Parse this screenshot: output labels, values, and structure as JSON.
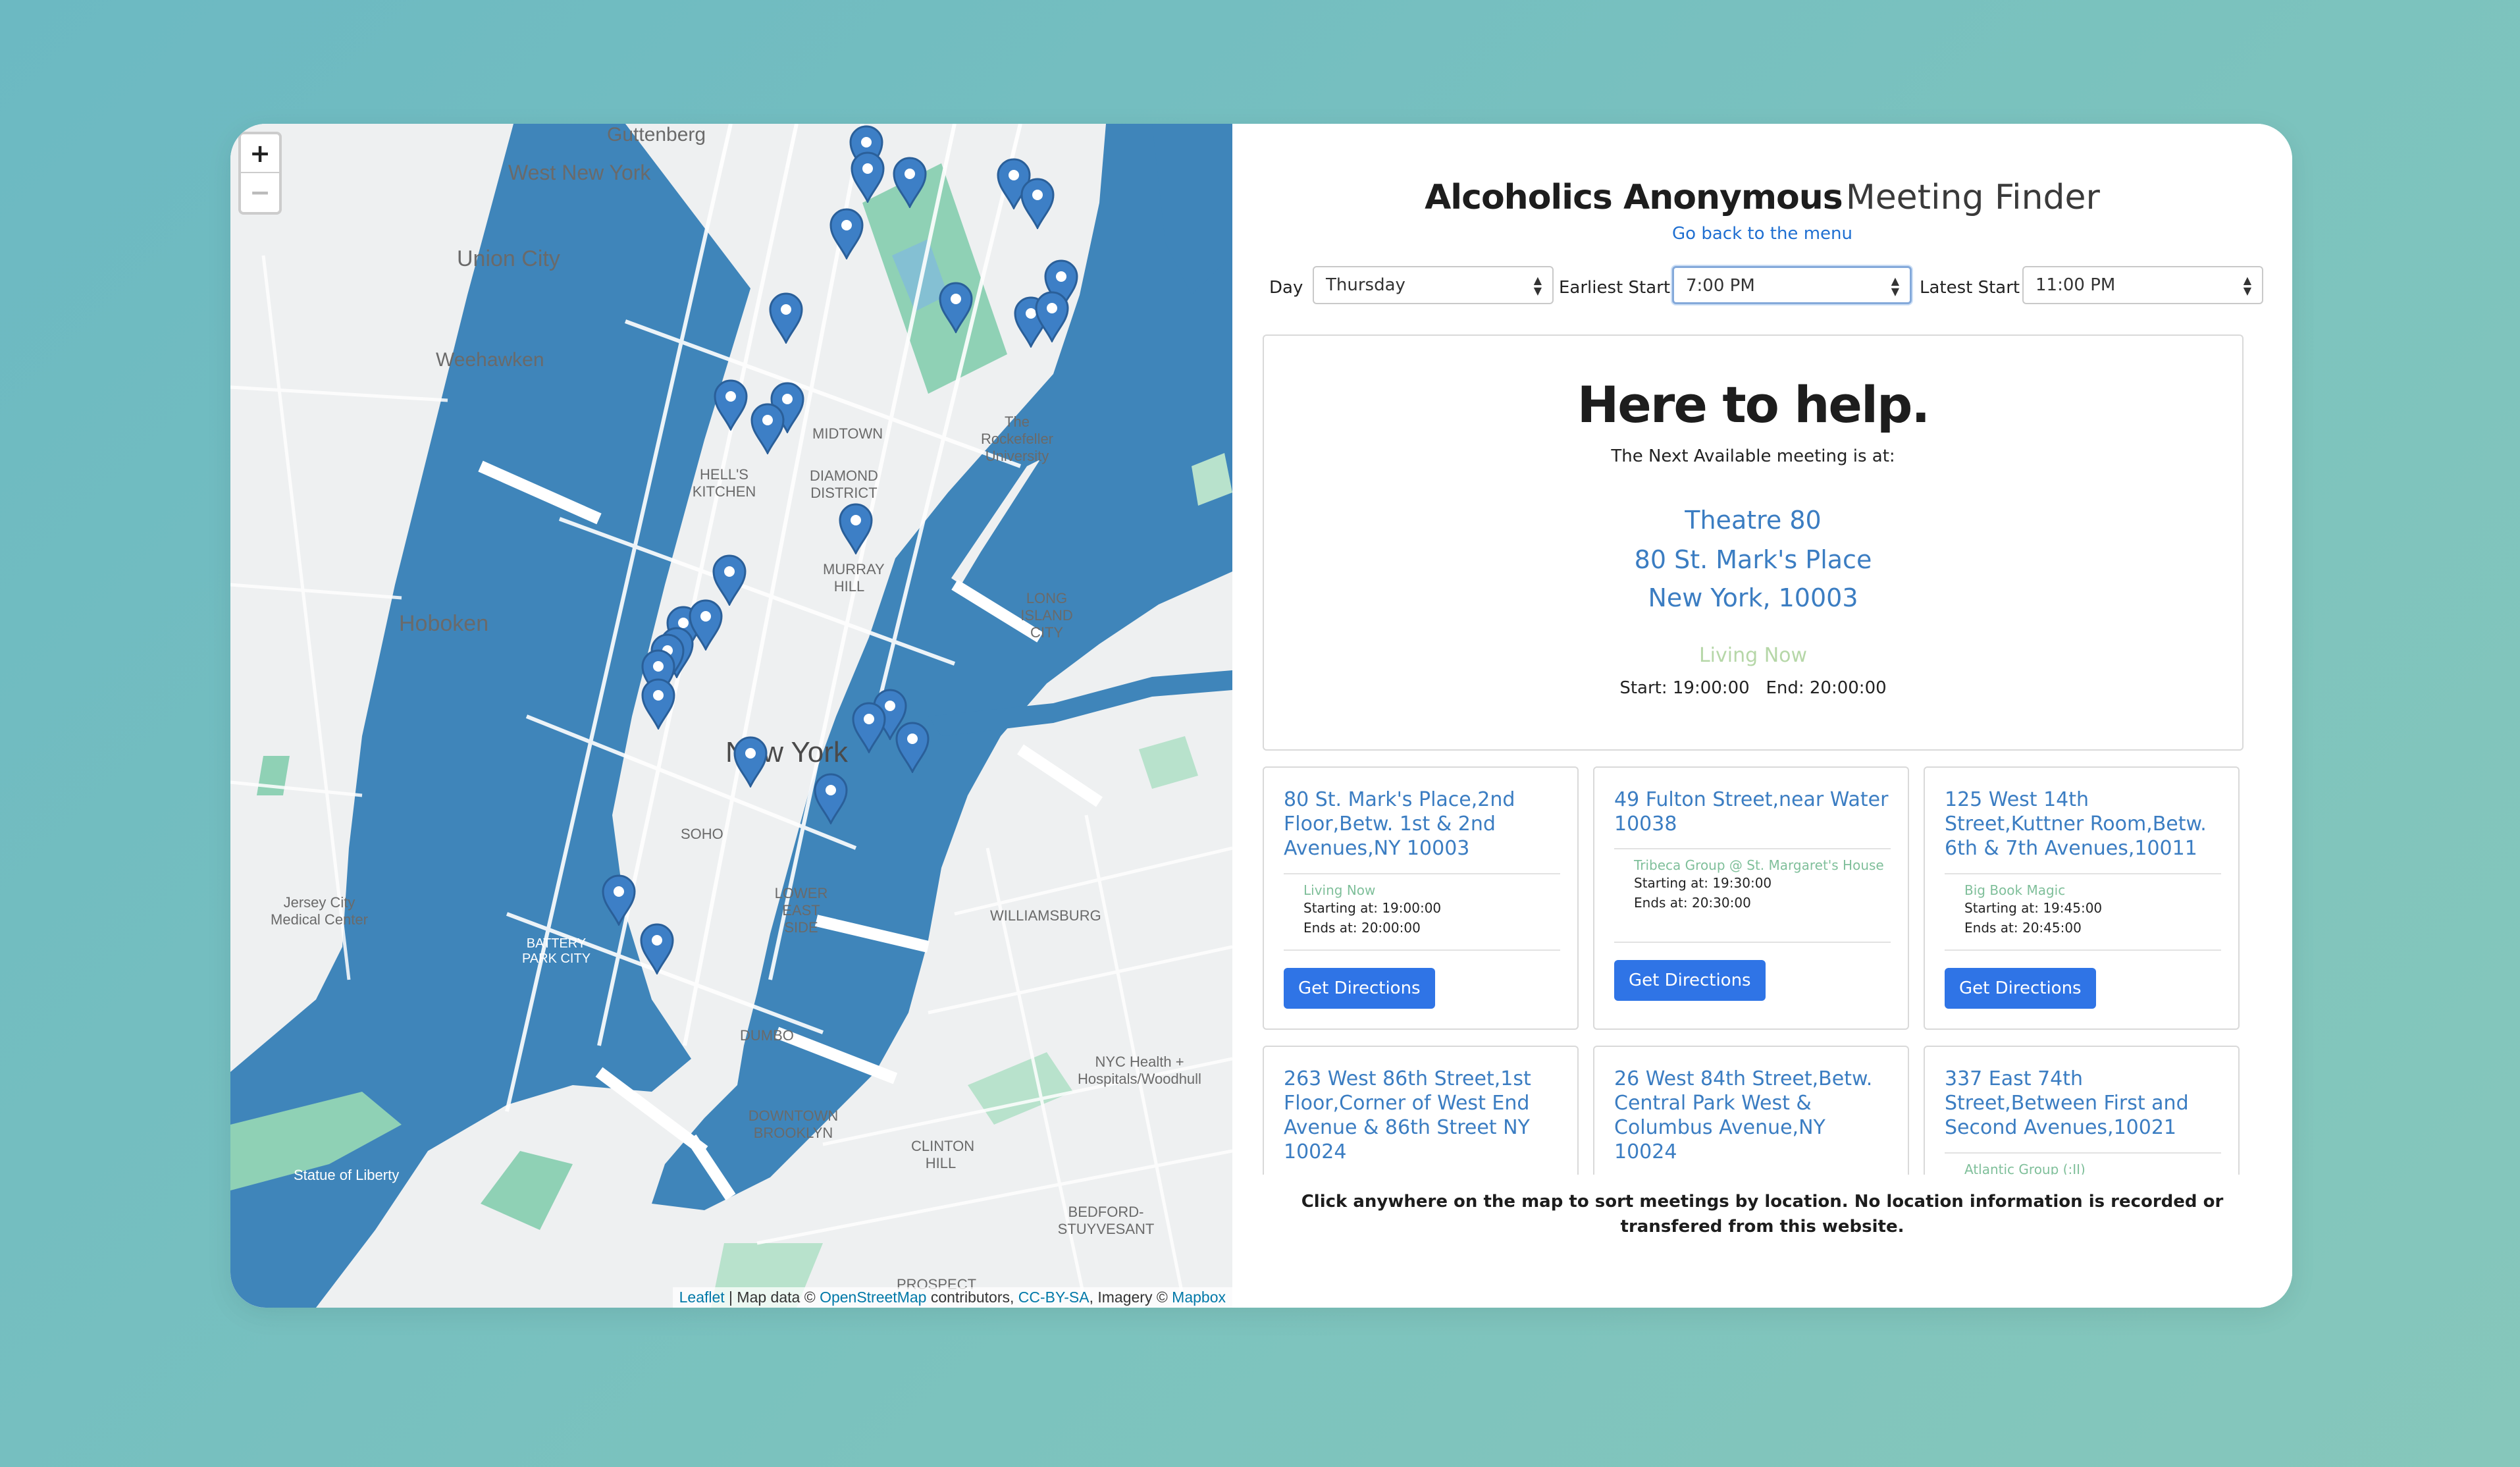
{
  "app": {
    "title_bold": "Alcoholics Anonymous",
    "title_light": "Meeting Finder",
    "back_link": "Go back to the menu"
  },
  "filters": {
    "day_label": "Day",
    "day_value": "Thursday",
    "earliest_label": "Earliest Start",
    "earliest_value": "7:00 PM",
    "latest_label": "Latest Start",
    "latest_value": "11:00 PM"
  },
  "hero": {
    "heading": "Here to help.",
    "subheading": "The Next Available meeting is at:",
    "venue": "Theatre 80",
    "street": "80 St. Mark's Place",
    "city": "New York, 10003",
    "group": "Living Now",
    "times": "Start: 19:00:00   End: 20:00:00"
  },
  "meetings": [
    {
      "address": "80 St. Mark's Place,2nd Floor,Betw. 1st & 2nd Avenues,NY 10003",
      "group": "Living Now",
      "start": "Starting at: 19:00:00",
      "end": "Ends at: 20:00:00",
      "button": "Get Directions"
    },
    {
      "address": "49 Fulton Street,near Water 10038",
      "group": "Tribeca Group @ St. Margaret's House",
      "start": "Starting at: 19:30:00",
      "end": "Ends at: 20:30:00",
      "button": "Get Directions"
    },
    {
      "address": "125 West 14th Street,Kuttner Room,Betw. 6th & 7th Avenues,10011",
      "group": "Big Book Magic",
      "start": "Starting at: 19:45:00",
      "end": "Ends at: 20:45:00",
      "button": "Get Directions"
    },
    {
      "address": "263 West 86th Street,1st Floor,Corner of West End Avenue & 86th Street NY 10024"
    },
    {
      "address": "26 West 84th Street,Betw. Central Park West & Columbus Avenue,NY 10024"
    },
    {
      "address": "337 East 74th Street,Between First and Second Avenues,10021",
      "group": "Atlantic Group (:II)"
    }
  ],
  "footer_note": "Click anywhere on the map to sort meetings by location. No location information is recorded or transfered from this website.",
  "map": {
    "zoom_in": "+",
    "zoom_out": "−",
    "attribution": {
      "leaflet": "Leaflet",
      "map_data": " | Map data © ",
      "osm": "OpenStreetMap",
      "contributors": " contributors, ",
      "license": "CC-BY-SA",
      "imagery": ", Imagery © ",
      "mapbox": "Mapbox"
    },
    "labels": [
      {
        "text": "Guttenberg"
      },
      {
        "text": "West New York"
      },
      {
        "text": "Union City"
      },
      {
        "text": "Weehawken"
      },
      {
        "text": "Hoboken"
      },
      {
        "text": "Jersey City Medical Center"
      },
      {
        "text": "New York"
      },
      {
        "text": "MIDTOWN"
      },
      {
        "text": "HELL'S KITCHEN"
      },
      {
        "text": "DIAMOND DISTRICT"
      },
      {
        "text": "SOHO"
      },
      {
        "text": "LOWER EAST SIDE"
      },
      {
        "text": "WILLIAMSBURG"
      },
      {
        "text": "DUMBO"
      },
      {
        "text": "DOWNTOWN BROOKLYN"
      },
      {
        "text": "LONG ISLAND CITY"
      },
      {
        "text": "NYC Health + Hospitals/Woodhull"
      },
      {
        "text": "Statue of Liberty"
      },
      {
        "text": "BATTERY PARK CITY"
      },
      {
        "text": "CLINTON HILL"
      },
      {
        "text": "BEDFORD-STUYVESANT"
      },
      {
        "text": "PROSPECT"
      },
      {
        "text": "The Rockefeller University"
      },
      {
        "text": "MURRAY HILL"
      }
    ]
  },
  "colors": {
    "water": "#3f85ba",
    "park": "#8fd1b5",
    "land": "#eef0f1",
    "link": "#3b7dc2",
    "button": "#2f74e6",
    "group_text": "#7fbf9a"
  }
}
